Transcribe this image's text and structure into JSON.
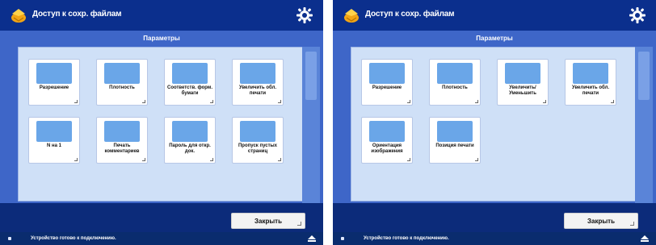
{
  "colors": {
    "accent": "#0b2f8d",
    "band": "#3e66c8",
    "content_bg": "#cfe0f7",
    "tile_bg": "#ffffff",
    "tile_illustration": "#6aa6e8"
  },
  "screens": [
    {
      "title": "Доступ к сохр. файлам",
      "section_title": "Параметры",
      "tiles": [
        {
          "label": "Разрешение",
          "icon": "resolution-icon"
        },
        {
          "label": "Плотность",
          "icon": "density-icon"
        },
        {
          "label": "Соответств. форм. бумаги",
          "icon": "paper-size-match-icon"
        },
        {
          "label": "Увеличить обл. печати",
          "icon": "enlarge-print-area-icon"
        },
        {
          "label": "N на 1",
          "icon": "n-on-1-icon"
        },
        {
          "label": "Печать комментариев",
          "icon": "print-comments-icon"
        },
        {
          "label": "Пароль для откр. док.",
          "icon": "document-password-icon"
        },
        {
          "label": "Пропуск пустых страниц",
          "icon": "skip-blank-pages-icon"
        }
      ],
      "close_label": "Закрыть",
      "status_text": "Устройство готово к подключению."
    },
    {
      "title": "Доступ к сохр. файлам",
      "section_title": "Параметры",
      "tiles": [
        {
          "label": "Разрешение",
          "icon": "resolution-icon"
        },
        {
          "label": "Плотность",
          "icon": "density-icon"
        },
        {
          "label": "Увеличить/Уменьшить",
          "icon": "zoom-icon"
        },
        {
          "label": "Увеличить обл. печати",
          "icon": "enlarge-print-area-icon"
        },
        {
          "label": "Ориентация изображения",
          "icon": "image-orientation-icon"
        },
        {
          "label": "Позиция печати",
          "icon": "print-position-icon"
        }
      ],
      "close_label": "Закрыть",
      "status_text": "Устройство готово к подключению."
    }
  ]
}
